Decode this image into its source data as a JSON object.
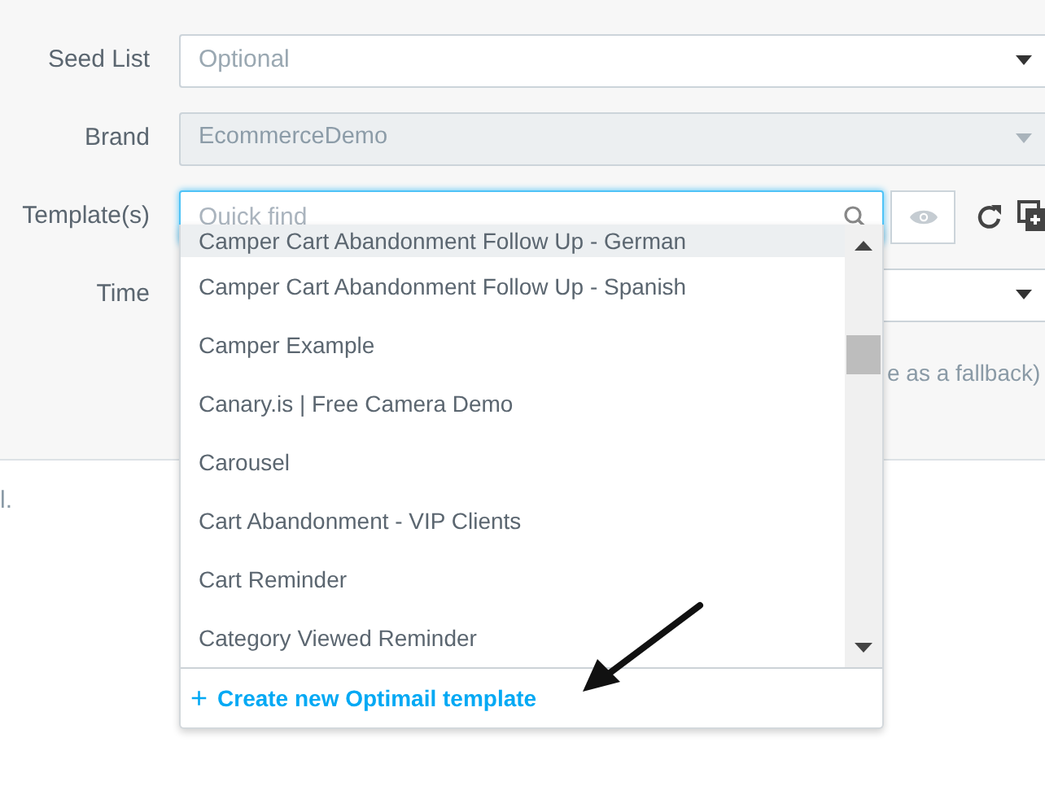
{
  "form": {
    "rows": [
      {
        "kind": "select",
        "label": "Seed List",
        "placeholder": "Optional",
        "disabled": false
      },
      {
        "kind": "select",
        "label": "Brand",
        "value": "EcommerceDemo",
        "disabled": true
      },
      {
        "kind": "template",
        "label": "Template(s)",
        "placeholder": "Quick find",
        "focused": true
      },
      {
        "kind": "select",
        "label": "Time",
        "disabled": false
      }
    ],
    "hint_fragment": "e as a fallback)"
  },
  "body_fragment": "l.",
  "dropdown": {
    "items": [
      {
        "label": "Camper Cart Abandonment Follow Up - German",
        "selected": true
      },
      {
        "label": "Camper Cart Abandonment Follow Up - Spanish",
        "selected": false
      },
      {
        "label": "Camper Example",
        "selected": false
      },
      {
        "label": "Canary.is | Free Camera Demo",
        "selected": false
      },
      {
        "label": "Carousel",
        "selected": false
      },
      {
        "label": "Cart Abandonment - VIP Clients",
        "selected": false
      },
      {
        "label": "Cart Reminder",
        "selected": false
      },
      {
        "label": "Category Viewed Reminder",
        "selected": false
      }
    ],
    "footer": {
      "icon": "+",
      "label": "Create new Optimail template"
    }
  }
}
